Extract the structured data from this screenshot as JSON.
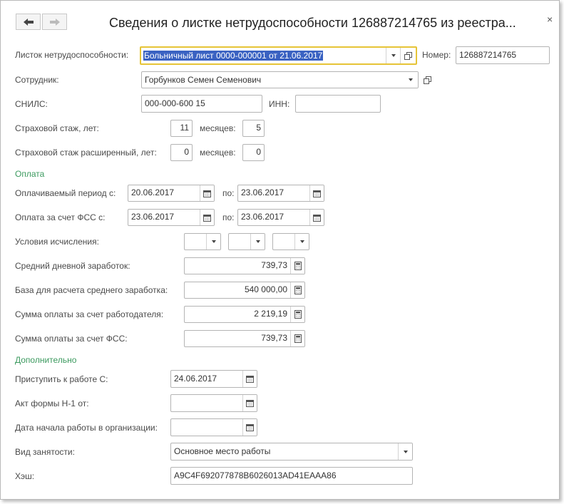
{
  "window": {
    "title": "Сведения о листке нетрудоспособности 126887214765 из реестра...",
    "close_glyph": "×"
  },
  "fields": {
    "sick_leave_label": "Листок нетрудоспособности:",
    "sick_leave_value": "Больничный лист 0000-000001 от 21.06.2017",
    "number_label": "Номер:",
    "number_value": "126887214765",
    "employee_label": "Сотрудник:",
    "employee_value": "Горбунков Семен Семенович",
    "snils_label": "СНИЛС:",
    "snils_value": "000-000-600 15",
    "inn_label": "ИНН:",
    "inn_value": "",
    "insurance_years_label": "Страховой стаж, лет:",
    "insurance_years_value": "11",
    "insurance_months_label": "месяцев:",
    "insurance_months_value": "5",
    "ext_insurance_years_label": "Страховой стаж расширенный, лет:",
    "ext_insurance_years_value": "0",
    "ext_insurance_months_label": "месяцев:",
    "ext_insurance_months_value": "0"
  },
  "payment": {
    "section_title": "Оплата",
    "period_label": "Оплачиваемый период с:",
    "period_from": "20.06.2017",
    "period_to_label": "по:",
    "period_to": "23.06.2017",
    "fss_label": "Оплата за счет ФСС с:",
    "fss_from": "23.06.2017",
    "fss_to_label": "по:",
    "fss_to": "23.06.2017",
    "conditions_label": "Условия исчисления:",
    "avg_daily_label": "Средний дневной заработок:",
    "avg_daily_value": "739,73",
    "base_label": "База для расчета среднего заработка:",
    "base_value": "540 000,00",
    "employer_sum_label": "Сумма оплаты за счет работодателя:",
    "employer_sum_value": "2 219,19",
    "fss_sum_label": "Сумма оплаты за счет ФСС:",
    "fss_sum_value": "739,73"
  },
  "additional": {
    "section_title": "Дополнительно",
    "return_label": "Приступить к работе С:",
    "return_value": "24.06.2017",
    "act_label": "Акт формы Н-1 от:",
    "act_value": " .  .",
    "start_label": "Дата начала работы в организации:",
    "start_value": " .  .",
    "employment_label": "Вид занятости:",
    "employment_value": "Основное место работы",
    "hash_label": "Хэш:",
    "hash_value": "A9C4F692077878B6026013AD41EAAA86"
  },
  "icons": {
    "back": "arrow-left-icon",
    "forward": "arrow-right-icon",
    "open": "open-form-icon",
    "calendar": "calendar-icon",
    "calculator": "calculator-icon",
    "dropdown": "chevron-down-icon"
  },
  "colors": {
    "section_green": "#3c9a5f",
    "focus_border": "#e6c437",
    "selection": "#3a62c2"
  }
}
